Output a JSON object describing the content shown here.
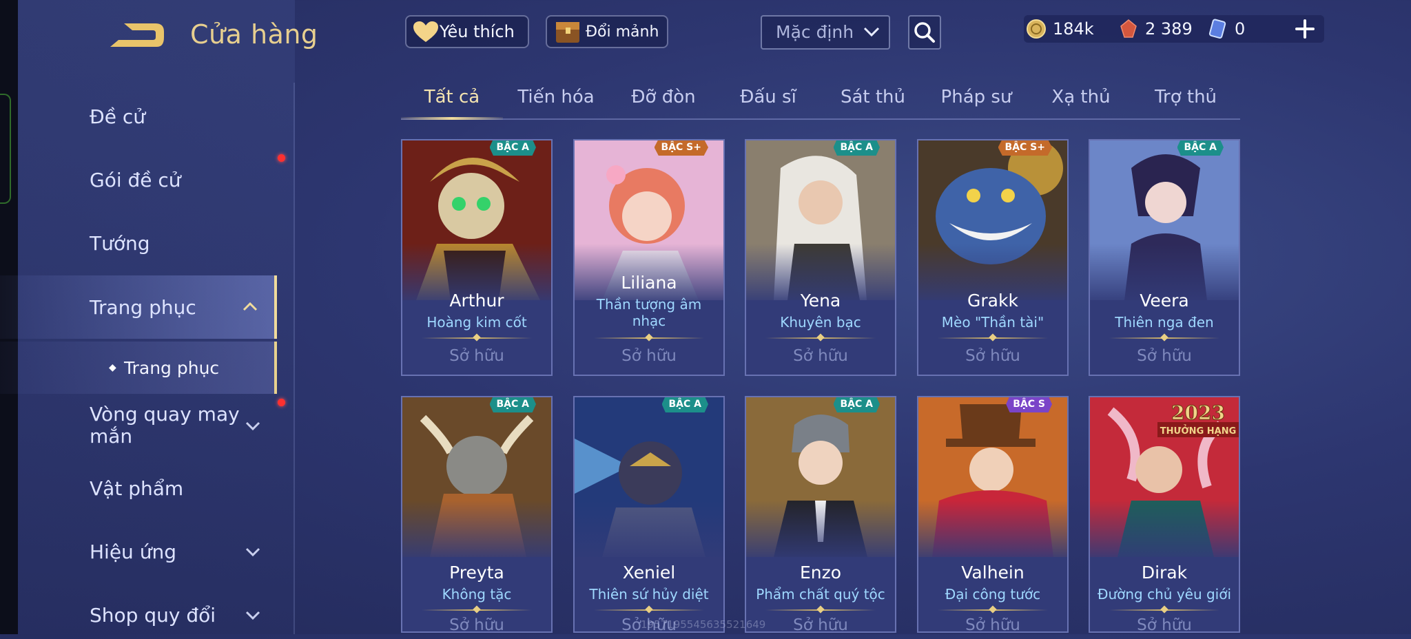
{
  "header": {
    "title": "Cửa hàng",
    "favorites_label": "Yêu thích",
    "exchange_label": "Đổi mảnh",
    "sort_value": "Mặc định"
  },
  "currency": {
    "gold": "184k",
    "vouchers": "2 389",
    "tickets": "0"
  },
  "sidebar": {
    "items": [
      {
        "label": "Đề cử"
      },
      {
        "label": "Gói đề cử"
      },
      {
        "label": "Tướng"
      },
      {
        "label": "Trang phục"
      },
      {
        "label": "Trang phục"
      },
      {
        "label": "Vòng quay may mắn"
      },
      {
        "label": "Vật phẩm"
      },
      {
        "label": "Hiệu ứng"
      },
      {
        "label": "Shop quy đổi"
      }
    ]
  },
  "tabs": [
    "Tất cả",
    "Tiến hóa",
    "Đỡ đòn",
    "Đấu sĩ",
    "Sát thủ",
    "Pháp sư",
    "Xạ thủ",
    "Trợ thủ"
  ],
  "owned_label": "Sở hữu",
  "cards": [
    {
      "hero": "Arthur",
      "skin": "Hoàng kim cốt",
      "rank": "BẬC A"
    },
    {
      "hero": "Liliana",
      "skin": "Thần tượng âm nhạc",
      "rank": "BẬC S+"
    },
    {
      "hero": "Yena",
      "skin": "Khuyên bạc",
      "rank": "BẬC A"
    },
    {
      "hero": "Grakk",
      "skin": "Mèo \"Thần tài\"",
      "rank": "BẬC S+"
    },
    {
      "hero": "Veera",
      "skin": "Thiên nga đen",
      "rank": "BẬC A"
    },
    {
      "hero": "Preyta",
      "skin": "Không tặc",
      "rank": "BẬC A"
    },
    {
      "hero": "Xeniel",
      "skin": "Thiên sứ hủy diệt",
      "rank": "BẬC A"
    },
    {
      "hero": "Enzo",
      "skin": "Phẩm chất quý tộc",
      "rank": "BẬC A"
    },
    {
      "hero": "Valhein",
      "skin": "Đại công tước",
      "rank": "BẬC S"
    },
    {
      "hero": "Dirak",
      "skin": "Đường chủ yêu giới",
      "rank": ""
    }
  ],
  "dirak_banner": {
    "year": "2023",
    "label": "THƯỞNG HẠNG"
  },
  "watermark": "1957195545635521649",
  "colors": {
    "accent_gold": "#f1dc9c",
    "skin_name_blue": "#9fd8ff",
    "rank_a": "#1c8f8a",
    "rank_splus": "#c46a2a",
    "rank_s": "#7a44c8",
    "notification_red": "#ff3030"
  }
}
